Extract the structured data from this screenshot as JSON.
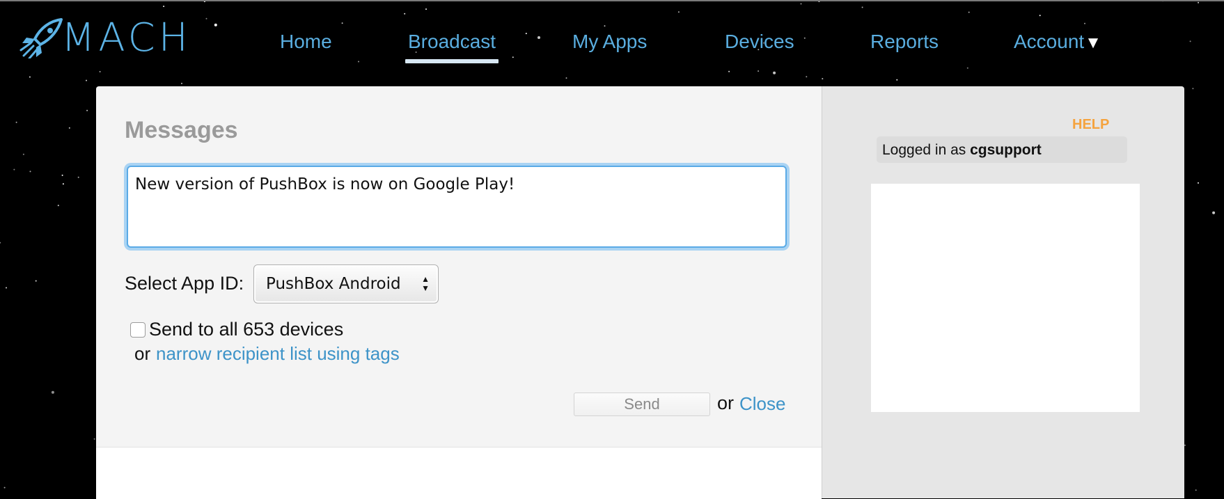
{
  "logo": {
    "text": "MACH",
    "icon": "rocket-icon",
    "color": "#5cb3e6"
  },
  "nav": {
    "items": [
      {
        "label": "Home",
        "active": false
      },
      {
        "label": "Broadcast",
        "active": true
      },
      {
        "label": "My Apps",
        "active": false
      },
      {
        "label": "Devices",
        "active": false
      },
      {
        "label": "Reports",
        "active": false
      },
      {
        "label": "Account",
        "active": false
      }
    ],
    "account_caret": "▼"
  },
  "messages": {
    "title": "Messages",
    "message_value": "New version of PushBox is now on Google Play!",
    "select_app_label": "Select App ID:",
    "selected_app": "PushBox Android",
    "send_all_label": "Send to all 653 devices",
    "send_all_checked": false,
    "or_text": "or",
    "narrow_link": "narrow recipient list using tags",
    "send_button": "Send",
    "close_link": "Close"
  },
  "sidebar": {
    "help_link": "HELP",
    "logged_in_prefix": "Logged in as",
    "username": "cgsupport"
  },
  "colors": {
    "nav_link": "#5aaee0",
    "link": "#3d93c8",
    "help": "#f5a33e",
    "focus_ring": "#a9d3f3"
  }
}
